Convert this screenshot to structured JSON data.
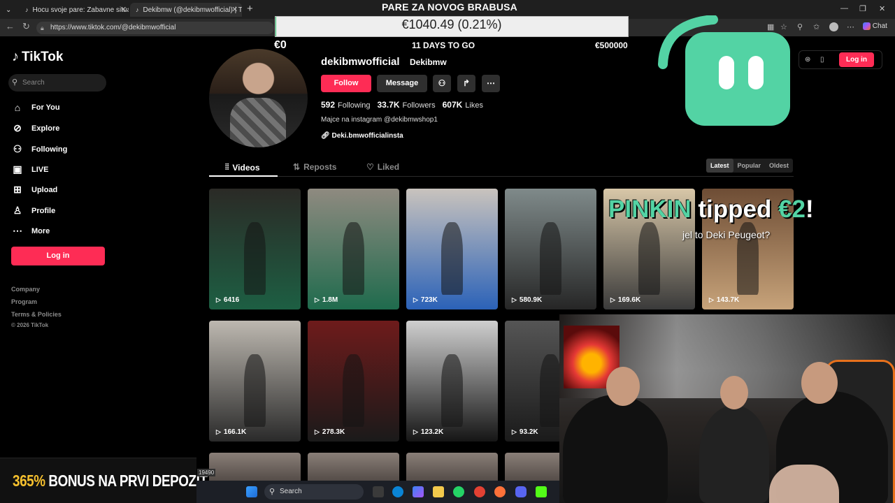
{
  "browser": {
    "tabs": [
      {
        "title": "Hocu svoje pare: Zabavne situacije"
      },
      {
        "title": "Dekibmw (@dekibmwofficial) | TikTok"
      }
    ],
    "url": "https://www.tiktok.com/@dekibmwofficial",
    "copilot_label": "Chat"
  },
  "sidebar": {
    "logo": "TikTok",
    "search_placeholder": "Search",
    "items": [
      {
        "label": "For You",
        "icon": "home-icon"
      },
      {
        "label": "Explore",
        "icon": "compass-icon"
      },
      {
        "label": "Following",
        "icon": "following-icon"
      },
      {
        "label": "LIVE",
        "icon": "live-icon"
      },
      {
        "label": "Upload",
        "icon": "upload-icon"
      },
      {
        "label": "Profile",
        "icon": "profile-icon"
      },
      {
        "label": "More",
        "icon": "more-icon"
      }
    ],
    "login_label": "Log in",
    "footer": [
      "Company",
      "Program",
      "Terms & Policies",
      "© 2026 TikTok"
    ]
  },
  "profile": {
    "username": "dekibmwofficial",
    "nickname": "Dekibmw",
    "follow_label": "Follow",
    "message_label": "Message",
    "following_count": "592",
    "following_label": "Following",
    "followers_count": "33.7K",
    "followers_label": "Followers",
    "likes_count": "607K",
    "likes_label": "Likes",
    "bio": "Majce na instagram @dekibmwshop1",
    "link": "Deki.bmwofficialinsta"
  },
  "content_tabs": {
    "videos": "Videos",
    "reposts": "Reposts",
    "liked": "Liked",
    "sort": [
      "Latest",
      "Popular",
      "Oldest"
    ],
    "sort_selected": "Latest"
  },
  "videos": [
    {
      "views": "6416",
      "colors": [
        "#2b2a26",
        "#1d5f43"
      ]
    },
    {
      "views": "1.8M",
      "colors": [
        "#8f8a80",
        "#1f6b4d"
      ]
    },
    {
      "views": "723K",
      "colors": [
        "#c9c3bd",
        "#2b62b8"
      ]
    },
    {
      "views": "580.9K",
      "colors": [
        "#7f8a8a",
        "#262626"
      ]
    },
    {
      "views": "169.6K",
      "colors": [
        "#d8c7a8",
        "#3a3a3a"
      ]
    },
    {
      "views": "143.7K",
      "colors": [
        "#6e4d35",
        "#c7a37a"
      ]
    },
    {
      "views": "166.1K",
      "colors": [
        "#bdb8b0",
        "#2a2a2a"
      ]
    },
    {
      "views": "278.3K",
      "colors": [
        "#6e1b1b",
        "#1a1a1a"
      ]
    },
    {
      "views": "123.2K",
      "colors": [
        "#cfcfcf",
        "#151515"
      ]
    },
    {
      "views": "93.2K",
      "colors": [
        "#555555",
        "#1a1a1a"
      ]
    }
  ],
  "header_right": {
    "login_label": "Log in"
  },
  "overlay": {
    "goal_title": "PARE ZA NOVOG BRABUSA",
    "amount": "€1040.49 (0.21%)",
    "progress_fraction": 0.0021,
    "start": "€0",
    "days_left": "11 DAYS TO GO",
    "goal": "€500000",
    "tip_name": "PINKIN",
    "tip_middle": "tipped",
    "tip_amount": "€2",
    "tip_exclaim": "!",
    "tip_message": "jel to Deki Peugeot?",
    "bonus_prefix": "365%",
    "bonus_rest": "BONUS NA PRVI DEPOZIT",
    "clip_number": "19490",
    "accent": "#53d3a4",
    "brand_red": "#fe2c55"
  },
  "taskbar": {
    "search_label": "Search"
  }
}
